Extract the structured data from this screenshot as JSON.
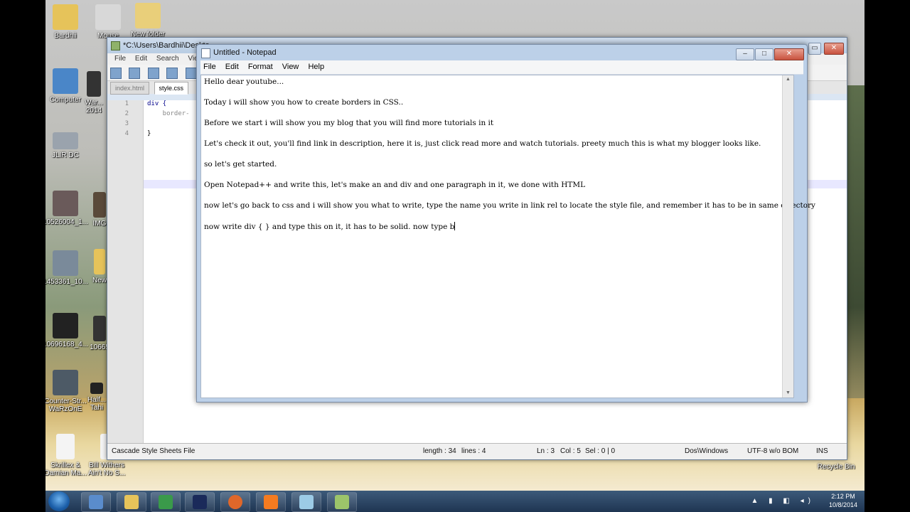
{
  "desktop": {
    "icons": [
      {
        "label": "Bardhii"
      },
      {
        "label": "Mouse"
      },
      {
        "label": "New folder"
      },
      {
        "label": "Computer"
      },
      {
        "label": "War... 2014"
      },
      {
        "label": "JLIR DC"
      },
      {
        "label": "10526004_1..."
      },
      {
        "label": "IMG"
      },
      {
        "label": "1453361_10..."
      },
      {
        "label": "New"
      },
      {
        "label": "10696168_4..."
      },
      {
        "label": "10665"
      },
      {
        "label": "Counter-Str... WaRzOnE"
      },
      {
        "label": "Half... Tahi"
      },
      {
        "label": "Skrillex & Damian Ma..."
      },
      {
        "label": "Bill Withers Ain't No S..."
      },
      {
        "label": "Recycle Bin"
      }
    ]
  },
  "npp": {
    "title": "*C:\\Users\\Bardhii\\Deskto",
    "menu": [
      "File",
      "Edit",
      "Search",
      "View"
    ],
    "tabs": [
      "index.html",
      "style.css"
    ],
    "code": {
      "line_numbers": [
        "1",
        "2",
        "3",
        "4"
      ],
      "lines": [
        "div {",
        "    border-",
        "",
        "}"
      ]
    },
    "status": {
      "filetype": "Cascade Style Sheets File",
      "length": "length : 34",
      "lines": "lines : 4",
      "ln": "Ln : 3",
      "col": "Col : 5",
      "sel": "Sel : 0 | 0",
      "eol": "Dos\\Windows",
      "encoding": "UTF-8 w/o BOM",
      "mode": "INS"
    }
  },
  "notepad": {
    "title": "Untitled - Notepad",
    "menu": [
      "File",
      "Edit",
      "Format",
      "View",
      "Help"
    ],
    "lines": [
      "Hello dear youtube...",
      "Today i will show you how to create borders in CSS..",
      "Before we start i will show you my blog that you will find more tutorials in it",
      "Let's check it out, you'll find link in description, here it is, just click read more and watch tutorials. preety much this is what my blogger looks like.",
      "so let's get started.",
      "Open Notepad++ and write this, let's make an and div and one paragraph in it, we done with HTML",
      "now let's go back to css and i will show you what to write, type the name you write in link rel to locate the style file, and remember it has to be in same directory",
      "now write div { } and type this on it, it has to be solid. now type b"
    ]
  },
  "taskbar": {
    "time": "2:12 PM",
    "date": "10/8/2014"
  }
}
